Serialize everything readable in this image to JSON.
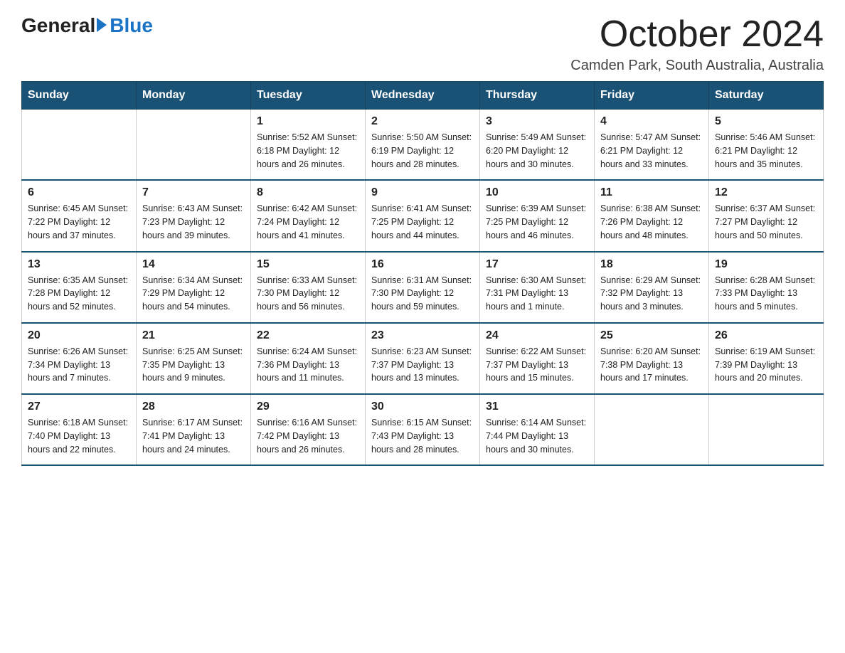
{
  "logo": {
    "general": "General",
    "blue": "Blue"
  },
  "title": "October 2024",
  "subtitle": "Camden Park, South Australia, Australia",
  "days_of_week": [
    "Sunday",
    "Monday",
    "Tuesday",
    "Wednesday",
    "Thursday",
    "Friday",
    "Saturday"
  ],
  "weeks": [
    [
      {
        "day": "",
        "info": ""
      },
      {
        "day": "",
        "info": ""
      },
      {
        "day": "1",
        "info": "Sunrise: 5:52 AM\nSunset: 6:18 PM\nDaylight: 12 hours\nand 26 minutes."
      },
      {
        "day": "2",
        "info": "Sunrise: 5:50 AM\nSunset: 6:19 PM\nDaylight: 12 hours\nand 28 minutes."
      },
      {
        "day": "3",
        "info": "Sunrise: 5:49 AM\nSunset: 6:20 PM\nDaylight: 12 hours\nand 30 minutes."
      },
      {
        "day": "4",
        "info": "Sunrise: 5:47 AM\nSunset: 6:21 PM\nDaylight: 12 hours\nand 33 minutes."
      },
      {
        "day": "5",
        "info": "Sunrise: 5:46 AM\nSunset: 6:21 PM\nDaylight: 12 hours\nand 35 minutes."
      }
    ],
    [
      {
        "day": "6",
        "info": "Sunrise: 6:45 AM\nSunset: 7:22 PM\nDaylight: 12 hours\nand 37 minutes."
      },
      {
        "day": "7",
        "info": "Sunrise: 6:43 AM\nSunset: 7:23 PM\nDaylight: 12 hours\nand 39 minutes."
      },
      {
        "day": "8",
        "info": "Sunrise: 6:42 AM\nSunset: 7:24 PM\nDaylight: 12 hours\nand 41 minutes."
      },
      {
        "day": "9",
        "info": "Sunrise: 6:41 AM\nSunset: 7:25 PM\nDaylight: 12 hours\nand 44 minutes."
      },
      {
        "day": "10",
        "info": "Sunrise: 6:39 AM\nSunset: 7:25 PM\nDaylight: 12 hours\nand 46 minutes."
      },
      {
        "day": "11",
        "info": "Sunrise: 6:38 AM\nSunset: 7:26 PM\nDaylight: 12 hours\nand 48 minutes."
      },
      {
        "day": "12",
        "info": "Sunrise: 6:37 AM\nSunset: 7:27 PM\nDaylight: 12 hours\nand 50 minutes."
      }
    ],
    [
      {
        "day": "13",
        "info": "Sunrise: 6:35 AM\nSunset: 7:28 PM\nDaylight: 12 hours\nand 52 minutes."
      },
      {
        "day": "14",
        "info": "Sunrise: 6:34 AM\nSunset: 7:29 PM\nDaylight: 12 hours\nand 54 minutes."
      },
      {
        "day": "15",
        "info": "Sunrise: 6:33 AM\nSunset: 7:30 PM\nDaylight: 12 hours\nand 56 minutes."
      },
      {
        "day": "16",
        "info": "Sunrise: 6:31 AM\nSunset: 7:30 PM\nDaylight: 12 hours\nand 59 minutes."
      },
      {
        "day": "17",
        "info": "Sunrise: 6:30 AM\nSunset: 7:31 PM\nDaylight: 13 hours\nand 1 minute."
      },
      {
        "day": "18",
        "info": "Sunrise: 6:29 AM\nSunset: 7:32 PM\nDaylight: 13 hours\nand 3 minutes."
      },
      {
        "day": "19",
        "info": "Sunrise: 6:28 AM\nSunset: 7:33 PM\nDaylight: 13 hours\nand 5 minutes."
      }
    ],
    [
      {
        "day": "20",
        "info": "Sunrise: 6:26 AM\nSunset: 7:34 PM\nDaylight: 13 hours\nand 7 minutes."
      },
      {
        "day": "21",
        "info": "Sunrise: 6:25 AM\nSunset: 7:35 PM\nDaylight: 13 hours\nand 9 minutes."
      },
      {
        "day": "22",
        "info": "Sunrise: 6:24 AM\nSunset: 7:36 PM\nDaylight: 13 hours\nand 11 minutes."
      },
      {
        "day": "23",
        "info": "Sunrise: 6:23 AM\nSunset: 7:37 PM\nDaylight: 13 hours\nand 13 minutes."
      },
      {
        "day": "24",
        "info": "Sunrise: 6:22 AM\nSunset: 7:37 PM\nDaylight: 13 hours\nand 15 minutes."
      },
      {
        "day": "25",
        "info": "Sunrise: 6:20 AM\nSunset: 7:38 PM\nDaylight: 13 hours\nand 17 minutes."
      },
      {
        "day": "26",
        "info": "Sunrise: 6:19 AM\nSunset: 7:39 PM\nDaylight: 13 hours\nand 20 minutes."
      }
    ],
    [
      {
        "day": "27",
        "info": "Sunrise: 6:18 AM\nSunset: 7:40 PM\nDaylight: 13 hours\nand 22 minutes."
      },
      {
        "day": "28",
        "info": "Sunrise: 6:17 AM\nSunset: 7:41 PM\nDaylight: 13 hours\nand 24 minutes."
      },
      {
        "day": "29",
        "info": "Sunrise: 6:16 AM\nSunset: 7:42 PM\nDaylight: 13 hours\nand 26 minutes."
      },
      {
        "day": "30",
        "info": "Sunrise: 6:15 AM\nSunset: 7:43 PM\nDaylight: 13 hours\nand 28 minutes."
      },
      {
        "day": "31",
        "info": "Sunrise: 6:14 AM\nSunset: 7:44 PM\nDaylight: 13 hours\nand 30 minutes."
      },
      {
        "day": "",
        "info": ""
      },
      {
        "day": "",
        "info": ""
      }
    ]
  ]
}
